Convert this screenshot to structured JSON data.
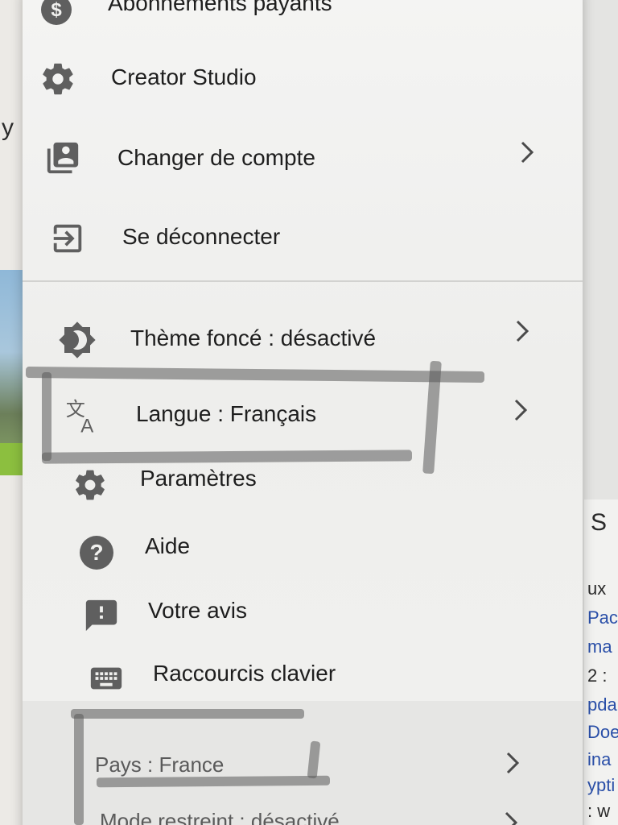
{
  "menu": {
    "items": [
      {
        "label": "Abonnements payants",
        "icon": "dollar-icon"
      },
      {
        "label": "Creator Studio",
        "icon": "gear-icon"
      },
      {
        "label": "Changer de compte",
        "icon": "switch-account-icon"
      },
      {
        "label": "Se déconnecter",
        "icon": "sign-out-icon"
      },
      {
        "label": "Thème foncé : désactivé",
        "icon": "brightness-icon"
      },
      {
        "label": "Langue : Français",
        "icon": "translate-icon"
      },
      {
        "label": "Paramètres",
        "icon": "gear-icon"
      },
      {
        "label": "Aide",
        "icon": "help-icon"
      },
      {
        "label": "Votre avis",
        "icon": "feedback-icon"
      },
      {
        "label": "Raccourcis clavier",
        "icon": "keyboard-icon"
      }
    ],
    "footer": [
      {
        "label": "Pays : France"
      },
      {
        "label": "Mode restreint : désactivé"
      }
    ]
  },
  "background": {
    "left_letter": "y",
    "right_lines": [
      "S",
      "ux",
      "Pac",
      "ma",
      "2 :",
      "pda",
      "Doe",
      "ina",
      "ypti",
      ": w"
    ]
  },
  "colors": {
    "menu_bg": "#f1f1ef",
    "icon": "#5f5f5f",
    "text": "#1e1e1e"
  }
}
